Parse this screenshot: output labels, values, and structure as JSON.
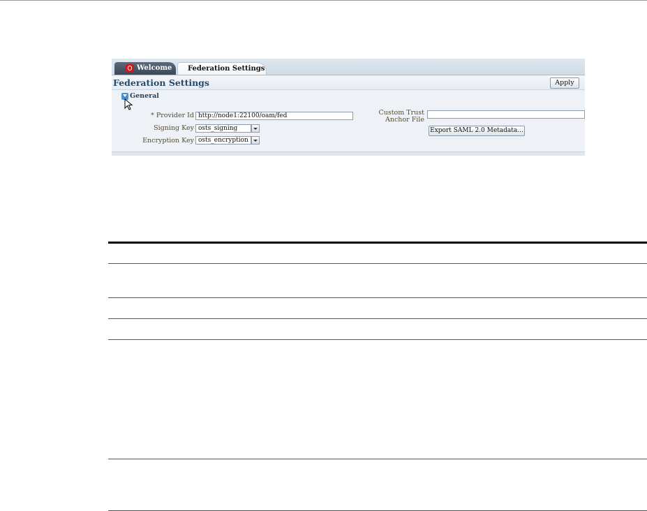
{
  "tabs": [
    {
      "label": "Welcome",
      "icon": "oracle-logo-icon"
    },
    {
      "label": "Federation Settings"
    }
  ],
  "panel": {
    "title": "Federation Settings",
    "apply_label": "Apply",
    "section_label": "General"
  },
  "form": {
    "provider_id_label": "Provider Id",
    "provider_id_required_marker": "*",
    "provider_id_value": "http://node1:22100/oam/fed",
    "signing_key_label": "Signing Key",
    "signing_key_value": "osts_signing",
    "encryption_key_label": "Encryption Key",
    "encryption_key_value": "osts_encryption",
    "custom_trust_label_line1": "Custom Trust",
    "custom_trust_label_line2": "Anchor File",
    "custom_trust_value": "",
    "export_label": "Export SAML 2.0 Metadata..."
  },
  "colors": {
    "tab_active_dark": "#3c4856",
    "title_blue": "#254a6b",
    "label_brown": "#5b4a22",
    "oracle_red": "#d5171d",
    "disclose_blue": "#4d8fd1"
  }
}
